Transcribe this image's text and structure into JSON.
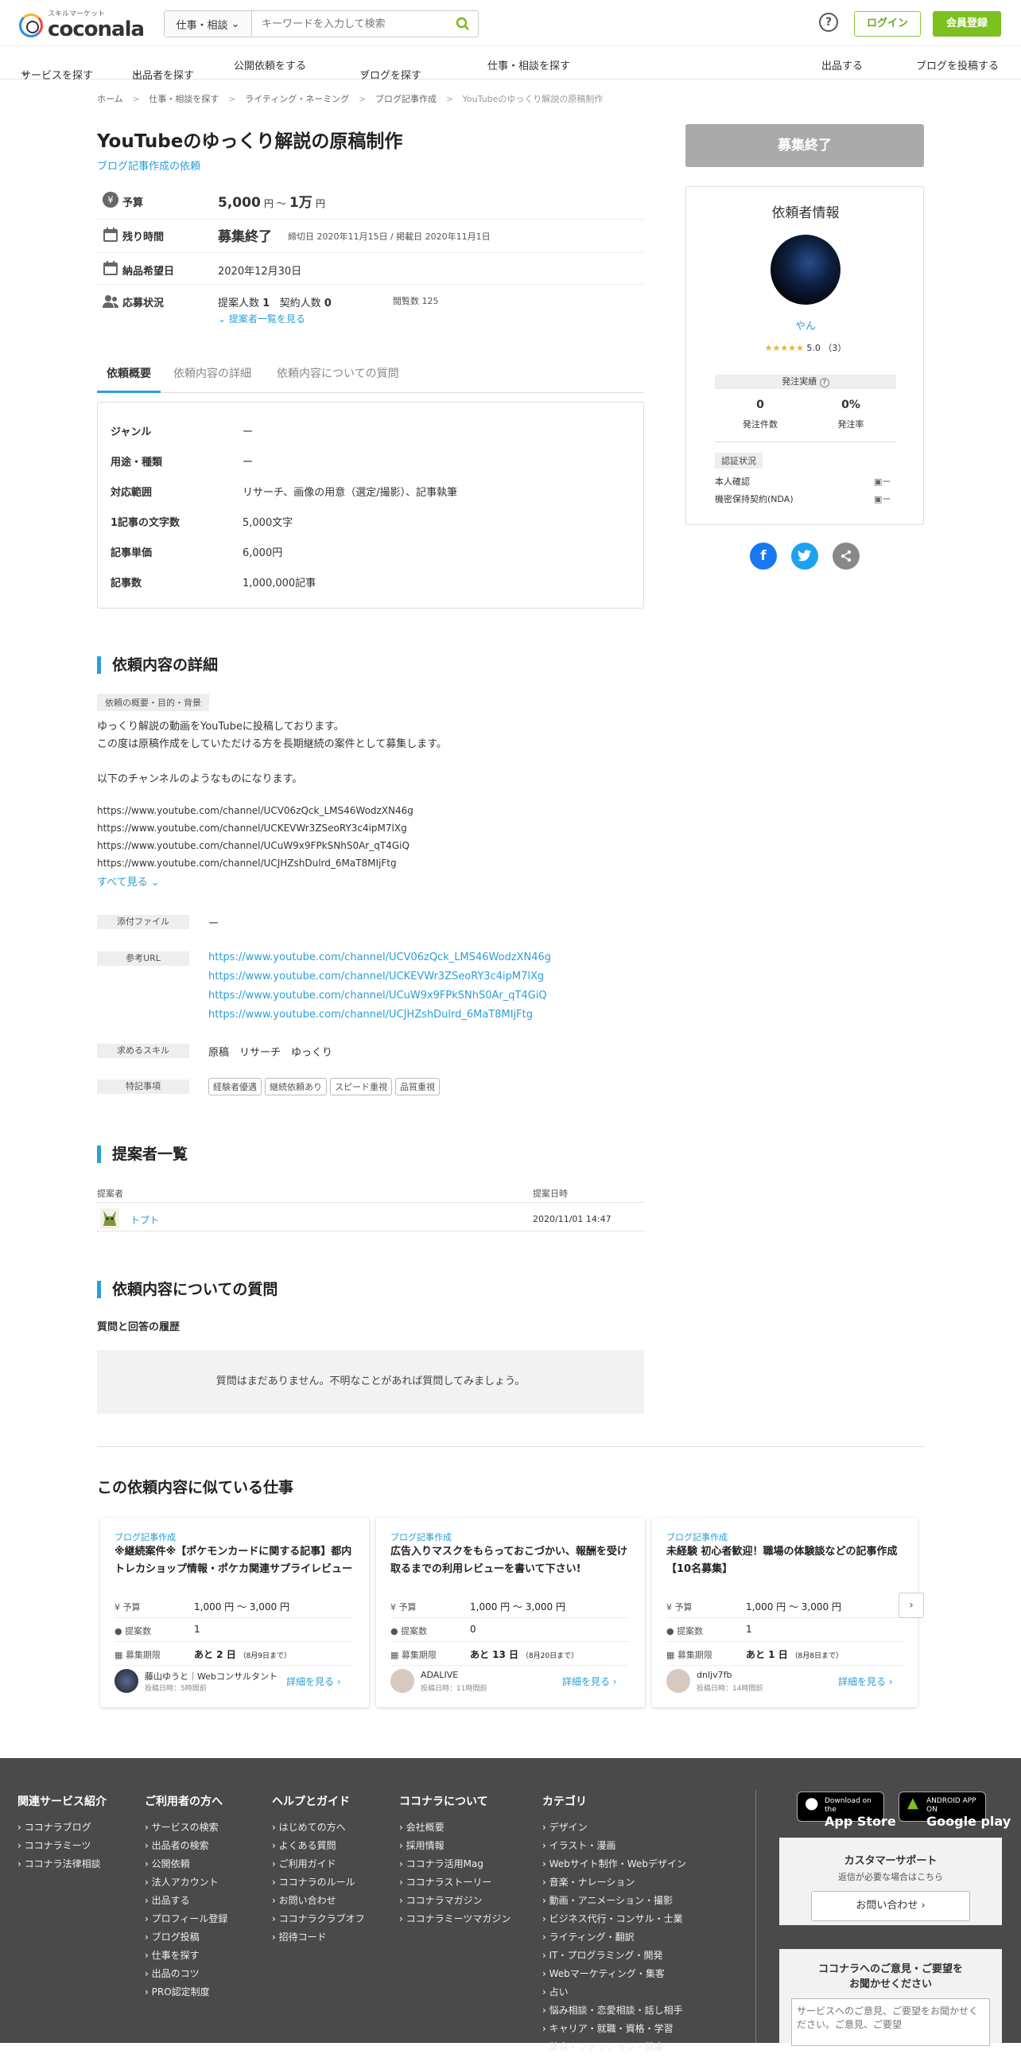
{
  "header": {
    "logo_sub": "スキルマーケット",
    "logo_text": "coconala",
    "search_category": "仕事・相談",
    "search_placeholder": "キーワードを入力して検索",
    "help": "?",
    "login": "ログイン",
    "register": "会員登録"
  },
  "nav": {
    "items": [
      "サービスを探す",
      "出品者を探す",
      "公開依頼をする",
      "ブログを探す",
      "仕事・相談を探す"
    ],
    "right": [
      "出品する",
      "ブログを投稿する"
    ]
  },
  "breadcrumb": [
    "ホーム",
    "仕事・相談を探す",
    "ライティング・ネーミング",
    "ブログ記事作成",
    "YouTubeのゆっくり解説の原稿制作"
  ],
  "request": {
    "title": "YouTubeのゆっくり解説の原稿制作",
    "category_link": "ブログ記事作成の依頼",
    "budget_label": "予算",
    "budget_min": "5,000",
    "budget_unit1": "円 〜",
    "budget_max": "1万",
    "budget_unit2": "円",
    "time_label": "残り時間",
    "time_value": "募集終了",
    "time_dates": "締切日 2020年11月15日 / 掲載日 2020年11月1日",
    "delivery_label": "納品希望日",
    "delivery_value": "2020年12月30日",
    "status_label": "応募状況",
    "proposals_label": "提案人数",
    "proposals": "1",
    "contracts_label": "契約人数",
    "contracts": "0",
    "views": "閲覧数 125",
    "see_proposers": "提案者一覧を見る"
  },
  "tabs": [
    "依頼概要",
    "依頼内容の詳細",
    "依頼内容についての質問"
  ],
  "spec": [
    {
      "k": "ジャンル",
      "v": "ー"
    },
    {
      "k": "用途・種類",
      "v": "ー"
    },
    {
      "k": "対応範囲",
      "v": "リサーチ、画像の用意（選定/撮影）、記事執筆"
    },
    {
      "k": "1記事の文字数",
      "v": "5,000文字"
    },
    {
      "k": "記事単価",
      "v": "6,000円"
    },
    {
      "k": "記事数",
      "v": "1,000,000記事"
    }
  ],
  "details": {
    "heading": "依頼内容の詳細",
    "tag": "依頼の概要・目的・背景",
    "lines": [
      "ゆっくり解説の動画をYouTubeに投稿しております。",
      "この度は原稿作成をしていただける方を長期継続の案件として募集します。",
      "",
      "以下のチャンネルのようなものになります。",
      "",
      "https://www.youtube.com/channel/UCV06zQck_LMS46WodzXN46g",
      "https://www.youtube.com/channel/UCKEVWr3ZSeoRY3c4ipM7lXg",
      "https://www.youtube.com/channel/UCuW9x9FPkSNhS0Ar_qT4GiQ",
      "https://www.youtube.com/channel/UCJHZshDulrd_6MaT8MIjFtg"
    ],
    "see_all": "すべて見る",
    "attach_label": "添付ファイル",
    "attach_value": "ー",
    "ref_label": "参考URL",
    "urls": [
      "https://www.youtube.com/channel/UCV06zQck_LMS46WodzXN46g",
      "https://www.youtube.com/channel/UCKEVWr3ZSeoRY3c4ipM7lXg",
      "https://www.youtube.com/channel/UCuW9x9FPkSNhS0Ar_qT4GiQ",
      "https://www.youtube.com/channel/UCJHZshDulrd_6MaT8MIjFtg"
    ],
    "skill_label": "求めるスキル",
    "skills": "原稿　リサーチ　ゆっくり",
    "special_label": "特記事項",
    "chips": [
      "経験者優遇",
      "継続依頼あり",
      "スピード重視",
      "品質重視"
    ]
  },
  "proposers": {
    "heading": "提案者一覧",
    "col_name": "提案者",
    "col_date": "提案日時",
    "name": "トプト",
    "date": "2020/11/01 14:47"
  },
  "questions": {
    "heading": "依頼内容についての質問",
    "sub": "質問と回答の履歴",
    "empty": "質問はまだありません。不明なことがあれば質問してみましょう。"
  },
  "sidebar": {
    "status_btn": "募集終了",
    "box_title": "依頼者情報",
    "user_name": "やん",
    "stars": "★★★★★",
    "rating": "5.0",
    "rating_count": "（3）",
    "order_label": "発注実績",
    "order_count": "0",
    "order_count_label": "発注件数",
    "order_rate": "0%",
    "order_rate_label": "発注率",
    "cert_label": "認証状況",
    "cert1": "本人確認",
    "cert2": "機密保持契約(NDA)",
    "cert_dash": "ー"
  },
  "similar": {
    "heading": "この依頼内容に似ている仕事",
    "budget_k": "予算",
    "proposals_k": "提案数",
    "deadline_k": "募集期限",
    "more": "詳細を見る",
    "cards": [
      {
        "cat": "ブログ記事作成",
        "title": "※継続案件※【ポケモンカードに関する記事】都内トレカショップ情報・ポケカ関連サプライレビュー",
        "budget": "1,000 円 〜 3,000 円",
        "proposals": "1",
        "deadline": "あと 2 日",
        "deadline_sub": "（8月9日まで）",
        "user": "藤山ゆうと｜Webコンサルタント",
        "posted": "投稿日時：5時間前"
      },
      {
        "cat": "ブログ記事作成",
        "title": "広告入りマスクをもらっておこづかい、報酬を受け取るまでの利用レビューを書いて下さい!",
        "budget": "1,000 円 〜 3,000 円",
        "proposals": "0",
        "deadline": "あと 13 日",
        "deadline_sub": "（8月20日まで）",
        "user": "ADALIVE",
        "posted": "投稿日時：11時間前"
      },
      {
        "cat": "ブログ記事作成",
        "title": "未経験 初心者歓迎！職場の体験談などの記事作成【10名募集】",
        "budget": "1,000 円 〜 3,000 円",
        "proposals": "1",
        "deadline": "あと 1 日",
        "deadline_sub": "（8月8日まで）",
        "user": "dnljv7fb",
        "posted": "投稿日時：14時間前"
      }
    ]
  },
  "footer": {
    "cols": [
      {
        "h": "関連サービス紹介",
        "items": [
          "ココナラブログ",
          "ココナラミーツ",
          "ココナラ法律相談"
        ]
      },
      {
        "h": "ご利用者の方へ",
        "items": [
          "サービスの検索",
          "出品者の検索",
          "公開依頼",
          "法人アカウント",
          "出品する",
          "プロフィール登録",
          "ブログ投稿",
          "仕事を探す",
          "出品のコツ",
          "PRO認定制度"
        ]
      },
      {
        "h": "ヘルプとガイド",
        "items": [
          "はじめての方へ",
          "よくある質問",
          "ご利用ガイド",
          "ココナラのルール",
          "お問い合わせ",
          "ココナラクラブオフ",
          "招待コード"
        ]
      },
      {
        "h": "ココナラについて",
        "items": [
          "会社概要",
          "採用情報",
          "ココナラ活用Mag",
          "ココナラストーリー",
          "ココナラマガジン",
          "ココナラミーツマガジン"
        ]
      },
      {
        "h": "カテゴリ",
        "items": [
          "デザイン",
          "イラスト・漫画",
          "Webサイト制作・Webデザイン",
          "音楽・ナレーション",
          "動画・アニメーション・撮影",
          "ビジネス代行・コンサル・士業",
          "ライティング・翻訳",
          "IT・プログラミング・開発",
          "Webマーケティング・集客",
          "占い",
          "悩み相談・恋愛相談・話し相手",
          "キャリア・就職・資格・学習",
          "美容・ファッション・健康"
        ]
      }
    ],
    "appstore_top": "Download on the",
    "appstore": "App Store",
    "gplay_top": "ANDROID APP ON",
    "gplay": "Google play",
    "support_title": "カスタマーサポート",
    "support_sub": "返信が必要な場合はこちら",
    "support_btn": "お問い合わせ",
    "feedback_title": "ココナラへのご意見・ご要望を",
    "feedback_title2": "お聞かせください",
    "feedback_placeholder": "サービスへのご意見、ご要望をお聞かせください。ご意見、ご要望"
  }
}
